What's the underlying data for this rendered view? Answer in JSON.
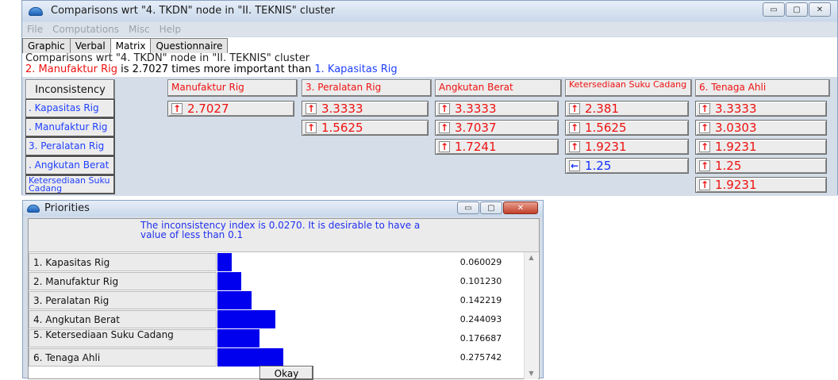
{
  "main_window": {
    "title": "Comparisons wrt \"4. TKDN\" node in \"II. TEKNIS\" cluster",
    "window_buttons": {
      "minimize": "▭",
      "maximize": "▢",
      "close": "✕"
    },
    "menu": [
      "File",
      "Computations",
      "Misc",
      "Help"
    ],
    "tabs": [
      "Graphic",
      "Verbal",
      "Matrix",
      "Questionnaire"
    ],
    "active_tab": "Matrix",
    "info": {
      "line1": "Comparisons wrt \"4. TKDN\" node in \"II. TEKNIS\" cluster",
      "line2_item": "2. Manufaktur Rig",
      "line2_mid": " is 2.7027 times more important than ",
      "line2_target": "1. Kapasitas Rig"
    },
    "matrix": {
      "inconsistency_label": "Inconsistency",
      "column_headers": [
        "Manufaktur Rig",
        "3. Peralatan Rig",
        "Angkutan Berat",
        "Ketersediaan Suku Cadang",
        "6. Tenaga Ahli"
      ],
      "row_headers": [
        ". Kapasitas Rig",
        ". Manufaktur Rig",
        "3. Peralatan Rig",
        ". Angkutan Berat",
        "Ketersediaan Suku Cadang"
      ],
      "cells": [
        [
          {
            "arrow": "up",
            "value": "2.7027"
          },
          {
            "arrow": "up",
            "value": "3.3333"
          },
          {
            "arrow": "up",
            "value": "3.3333"
          },
          {
            "arrow": "up",
            "value": "2.381"
          },
          {
            "arrow": "up",
            "value": "3.3333"
          }
        ],
        [
          null,
          {
            "arrow": "up",
            "value": "1.5625"
          },
          {
            "arrow": "up",
            "value": "3.7037"
          },
          {
            "arrow": "up",
            "value": "1.5625"
          },
          {
            "arrow": "up",
            "value": "3.0303"
          }
        ],
        [
          null,
          null,
          {
            "arrow": "up",
            "value": "1.7241"
          },
          {
            "arrow": "up",
            "value": "1.9231"
          },
          {
            "arrow": "up",
            "value": "1.9231"
          }
        ],
        [
          null,
          null,
          null,
          {
            "arrow": "left",
            "value": "1.25"
          },
          {
            "arrow": "up",
            "value": "1.25"
          }
        ],
        [
          null,
          null,
          null,
          null,
          {
            "arrow": "up",
            "value": "1.9231"
          }
        ]
      ]
    }
  },
  "priorities_window": {
    "title": "Priorities",
    "message": "The inconsistency index is 0.0270.  It is desirable to have a value of less than 0.1",
    "items": [
      {
        "label": "1. Kapasitas Rig",
        "value": "0.060029",
        "fraction": 0.060029
      },
      {
        "label": "2. Manufaktur Rig",
        "value": "0.101230",
        "fraction": 0.10123
      },
      {
        "label": "3. Peralatan Rig",
        "value": "0.142219",
        "fraction": 0.142219
      },
      {
        "label": "4. Angkutan Berat",
        "value": "0.244093",
        "fraction": 0.244093
      },
      {
        "label": "5. Ketersediaan Suku Cadang",
        "value": "0.176687",
        "fraction": 0.176687
      },
      {
        "label": "6. Tenaga Ahli",
        "value": "0.275742",
        "fraction": 0.275742
      }
    ],
    "okay_label": "Okay",
    "bar_color": "#0000ee"
  },
  "colors": {
    "accent_red": "#ee1111",
    "accent_blue": "#2040ff"
  }
}
